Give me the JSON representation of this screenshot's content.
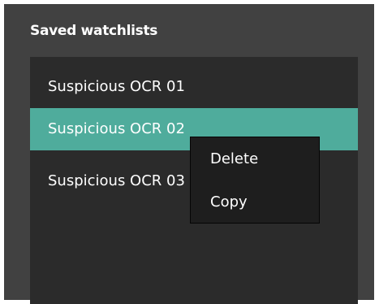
{
  "panel": {
    "title": "Saved watchlists"
  },
  "watchlists": [
    {
      "label": "Suspicious OCR 01",
      "selected": false
    },
    {
      "label": "Suspicious OCR 02",
      "selected": true
    },
    {
      "label": "Suspicious OCR 03",
      "selected": false
    }
  ],
  "context_menu": {
    "items": [
      {
        "label": "Delete"
      },
      {
        "label": "Copy"
      }
    ]
  },
  "colors": {
    "panel_background": "#414141",
    "list_background": "#2b2b2b",
    "selected_background": "#4fac9c",
    "menu_background": "#1e1e1e",
    "text": "#ffffff"
  }
}
